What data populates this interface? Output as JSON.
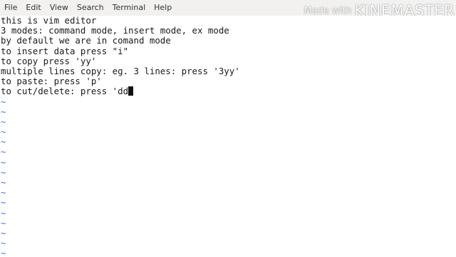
{
  "menubar": {
    "items": [
      "File",
      "Edit",
      "View",
      "Search",
      "Terminal",
      "Help"
    ]
  },
  "watermark": {
    "prefix": "Made with",
    "brand": "KINEMASTER"
  },
  "editor": {
    "lines": [
      "this is vim editor",
      "3 modes: command mode, insert mode, ex mode",
      "by default we are in comand mode",
      "to insert data press \"i\"",
      "to copy press 'yy'",
      "multiple lines copy: eg. 3 lines: press '3yy'",
      "to paste: press 'p'",
      "to cut/delete: press 'dd"
    ],
    "empty_line_marker": "~",
    "empty_line_count": 16
  },
  "colors": {
    "tilde": "#4a6ee0",
    "text": "#1a1a1a",
    "menubar_bg": "#f2f1f0"
  }
}
